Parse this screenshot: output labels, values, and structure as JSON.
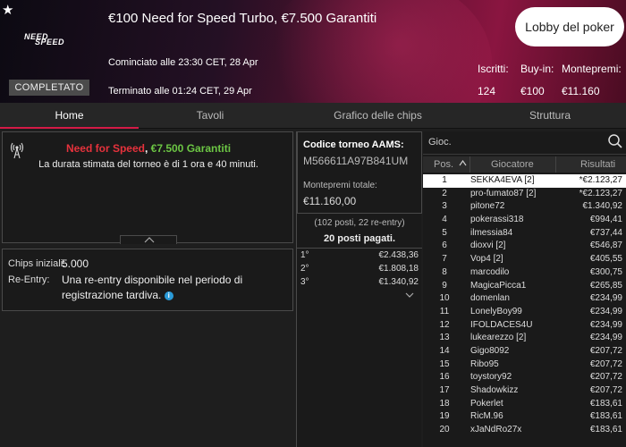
{
  "header": {
    "logo_top": "NEED",
    "logo_bottom": "SPEED",
    "status_badge": "COMPLETATO",
    "title": "€100 Need for Speed Turbo, €7.500 Garantiti",
    "started": "Cominciato alle 23:30 CET, 28 Apr",
    "ended": "Terminato alle 01:24 CET, 29 Apr",
    "lobby_button": "Lobby del poker",
    "stats": {
      "iscritti_label": "Iscritti:",
      "iscritti_value": "124",
      "buyin_label": "Buy-in:",
      "buyin_value": "€100",
      "montepremi_label": "Montepremi:",
      "montepremi_value": "€11.160"
    }
  },
  "tabs": [
    "Home",
    "Tavoli",
    "Grafico delle chips",
    "Struttura"
  ],
  "active_tab": "Home",
  "info": {
    "title_red": "Need for Speed",
    "title_sep": ", ",
    "title_green": "€7.500 Garantiti",
    "description": "La durata stimata del torneo è di 1 ora e 40 minuti."
  },
  "chips": {
    "chips_label": "Chips iniziali:",
    "chips_value": "5.000",
    "reentry_label": "Re-Entry:",
    "reentry_value": "Una re-entry disponibile nel periodo di registrazione tardiva.",
    "info_glyph": "i"
  },
  "tournament": {
    "code_label": "Codice torneo AAMS:",
    "code_value": "M566611A97B841UM",
    "prizepool_label": "Montepremi totale:",
    "prizepool_value": "€11.160,00",
    "places_text": "(102 posti, 22 re-entry)",
    "paid_text": "20 posti pagati.",
    "prizes": [
      {
        "place": "1°",
        "amount": "€2.438,36"
      },
      {
        "place": "2°",
        "amount": "€1.808,18"
      },
      {
        "place": "3°",
        "amount": "€1.340,92"
      }
    ]
  },
  "players": {
    "search_placeholder": "Gioc.",
    "col_pos": "Pos.",
    "col_player": "Giocatore",
    "col_result": "Risultati",
    "selected_index": 0,
    "rows": [
      {
        "pos": "1",
        "name": "SEKKA4EVA [2]",
        "result": "*€2.123,27"
      },
      {
        "pos": "2",
        "name": "pro-fumato87 [2]",
        "result": "*€2.123,27"
      },
      {
        "pos": "3",
        "name": "pitone72",
        "result": "€1.340,92"
      },
      {
        "pos": "4",
        "name": "pokerassi318",
        "result": "€994,41"
      },
      {
        "pos": "5",
        "name": "ilmessia84",
        "result": "€737,44"
      },
      {
        "pos": "6",
        "name": "dioxvi [2]",
        "result": "€546,87"
      },
      {
        "pos": "7",
        "name": "Vop4 [2]",
        "result": "€405,55"
      },
      {
        "pos": "8",
        "name": "marcodilo",
        "result": "€300,75"
      },
      {
        "pos": "9",
        "name": "MagicaPicca1",
        "result": "€265,85"
      },
      {
        "pos": "10",
        "name": "domenlan",
        "result": "€234,99"
      },
      {
        "pos": "11",
        "name": "LonelyBoy99",
        "result": "€234,99"
      },
      {
        "pos": "12",
        "name": "IFOLDACES4U",
        "result": "€234,99"
      },
      {
        "pos": "13",
        "name": "lukearezzo [2]",
        "result": "€234,99"
      },
      {
        "pos": "14",
        "name": "Gigo8092",
        "result": "€207,72"
      },
      {
        "pos": "15",
        "name": "Ribo95",
        "result": "€207,72"
      },
      {
        "pos": "16",
        "name": "toystory92",
        "result": "€207,72"
      },
      {
        "pos": "17",
        "name": "Shadowkizz",
        "result": "€207,72"
      },
      {
        "pos": "18",
        "name": "Pokerlet",
        "result": "€183,61"
      },
      {
        "pos": "19",
        "name": "RicM.96",
        "result": "€183,61"
      },
      {
        "pos": "20",
        "name": "xJaNdRo27x",
        "result": "€183,61"
      }
    ]
  }
}
